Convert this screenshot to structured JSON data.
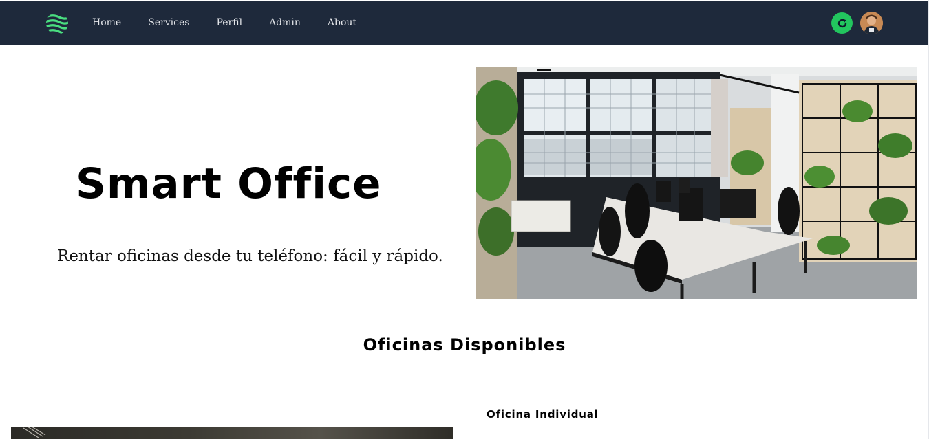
{
  "nav": {
    "logo_icon": "striped-globe-icon",
    "links": [
      "Home",
      "Services",
      "Perfil",
      "Admin",
      "About"
    ],
    "refresh_icon": "refresh-icon",
    "avatar_icon": "user-avatar",
    "colors": {
      "background": "#1e293b",
      "accent": "#22c55e"
    }
  },
  "hero": {
    "title": "Smart Office",
    "subtitle": "Rentar oficinas desde tu teléfono: fácil y rápido.",
    "image": "office-interior-photo"
  },
  "offices": {
    "title": "Oficinas Disponibles",
    "cards": [
      {
        "title": "Oficina Individual",
        "image": "office-photo"
      }
    ]
  }
}
